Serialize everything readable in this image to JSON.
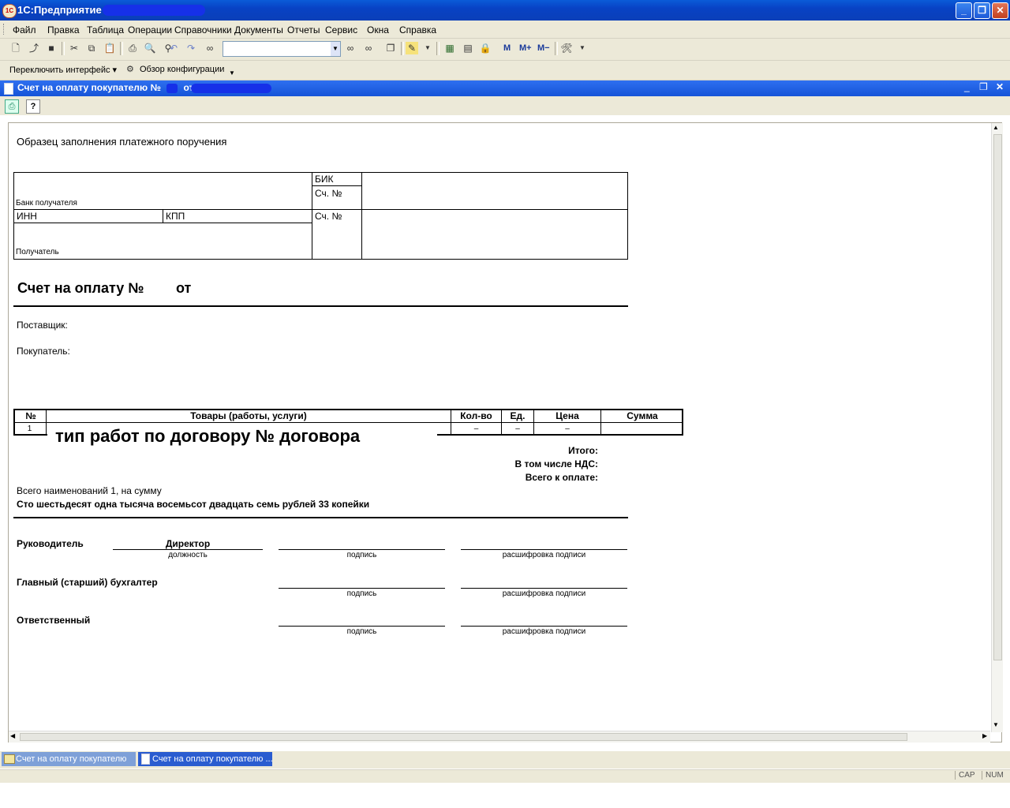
{
  "window": {
    "title": "1С:Предприятие",
    "minimize": "_",
    "maximize": "❐",
    "close": "✕"
  },
  "menu": [
    "Файл",
    "Правка",
    "Таблица",
    "Операции",
    "Справочники",
    "Документы",
    "Отчеты",
    "Сервис",
    "Окна",
    "Справка"
  ],
  "toolbar": {
    "search_value": "",
    "m_labels": [
      "M",
      "M+",
      "M−"
    ]
  },
  "toolbar2": {
    "switch_interface": "Переключить интерфейс ▾",
    "config_overview": "Обзор конфигурации"
  },
  "document_window": {
    "title_prefix": "Счет на оплату покупателю №",
    "title_from": "от"
  },
  "document": {
    "sample_heading": "Образец заполнения платежного поручения",
    "bank_block": {
      "bank_label": "Банк получателя",
      "bik": "БИК",
      "account1": "Сч. №",
      "inn": "ИНН",
      "kpp": "КПП",
      "account2": "Сч. №",
      "recipient": "Получатель"
    },
    "invoice_title": "Счет на оплату №",
    "invoice_from": "от",
    "supplier_label": "Поставщик:",
    "buyer_label": "Покупатель:",
    "table": {
      "headers": [
        "№",
        "Товары (работы, услуги)",
        "Кол-во",
        "Ед.",
        "Цена",
        "Сумма"
      ],
      "rows": [
        {
          "num": "1",
          "item": "тип работ по договору № договора",
          "qty": "–",
          "unit": "–",
          "price": "–",
          "sum": ""
        }
      ]
    },
    "totals": {
      "total": "Итого:",
      "vat": "В том числе НДС:",
      "to_pay": "Всего к оплате:"
    },
    "summary": "Всего наименований 1, на сумму",
    "amount_words": "Сто шестьдесят одна тысяча восемьсот двадцать семь рублей 33 копейки",
    "signatures": {
      "head_label": "Руководитель",
      "head_position": "Директор",
      "position_caption": "должность",
      "sign_caption": "подпись",
      "decode_caption": "расшифровка подписи",
      "chief_accountant_label": "Главный (старший) бухгалтер",
      "responsible_label": "Ответственный"
    }
  },
  "taskbar": [
    "Счет на оплату покупателю",
    "Счет на оплату покупателю ..."
  ],
  "statusbar": {
    "caps": "CAP",
    "num": "NUM"
  }
}
